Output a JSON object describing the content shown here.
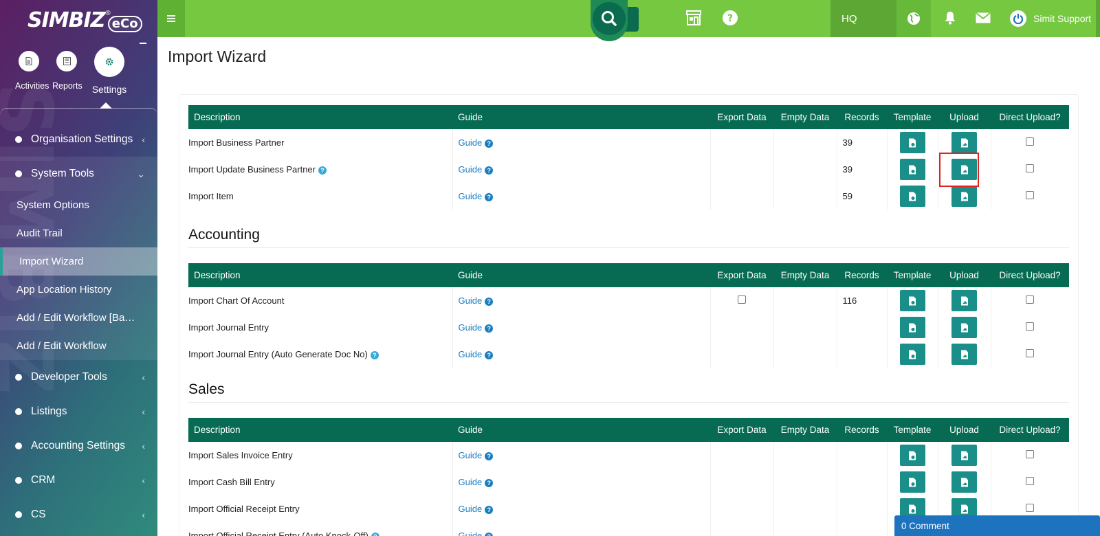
{
  "app": {
    "logo_text": "SIMBIZ",
    "logo_reg": "®",
    "logo_eco": "eCo"
  },
  "sidebar": {
    "top_nav": [
      {
        "label": "Activities",
        "icon": "document-icon"
      },
      {
        "label": "Reports",
        "icon": "report-icon"
      },
      {
        "label": "Settings",
        "icon": "gear-icon"
      }
    ],
    "menu": {
      "organisation": "Organisation Settings",
      "system_tools": "System Tools",
      "sub": {
        "system_options": "System Options",
        "audit_trail": "Audit Trail",
        "import_wizard": "Import Wizard",
        "app_location": "App Location History",
        "add_edit_workflow_ba": "Add / Edit Workflow [Ba…",
        "add_edit_workflow": "Add / Edit Workflow"
      },
      "developer_tools": "Developer Tools",
      "listings": "Listings",
      "accounting_settings": "Accounting Settings",
      "crm": "CRM",
      "cs": "CS"
    }
  },
  "topbar": {
    "branch": "HQ",
    "user_name": "Simit Support"
  },
  "page": {
    "title": "Import Wizard"
  },
  "table_headers": {
    "description": "Description",
    "guide": "Guide",
    "export_data": "Export Data",
    "empty_data": "Empty Data",
    "records": "Records",
    "template": "Template",
    "upload": "Upload",
    "direct_upload": "Direct Upload?"
  },
  "guide_label": "Guide",
  "sections": {
    "general": {
      "rows": [
        {
          "description": "Import Business Partner",
          "records": "39"
        },
        {
          "description": "Import Update Business Partner",
          "records": "39"
        },
        {
          "description": "Import Item",
          "records": "59"
        }
      ]
    },
    "accounting": {
      "title": "Accounting",
      "rows": [
        {
          "description": "Import Chart Of Account",
          "records": "116"
        },
        {
          "description": "Import Journal Entry",
          "records": ""
        },
        {
          "description": "Import Journal Entry (Auto Generate Doc No)",
          "records": ""
        }
      ]
    },
    "sales": {
      "title": "Sales",
      "rows": [
        {
          "description": "Import Sales Invoice Entry",
          "records": ""
        },
        {
          "description": "Import Cash Bill Entry",
          "records": ""
        },
        {
          "description": "Import Official Receipt Entry",
          "records": ""
        },
        {
          "description": "Import Official Receipt Entry (Auto Knock-Off)",
          "records": ""
        }
      ]
    }
  },
  "comment_bar": "0 Comment",
  "colors": {
    "topbar": "#76c841",
    "table_header": "#066b52",
    "file_button": "#1a8f8a",
    "link": "#1a7fc1",
    "highlight": "#e0231c"
  }
}
